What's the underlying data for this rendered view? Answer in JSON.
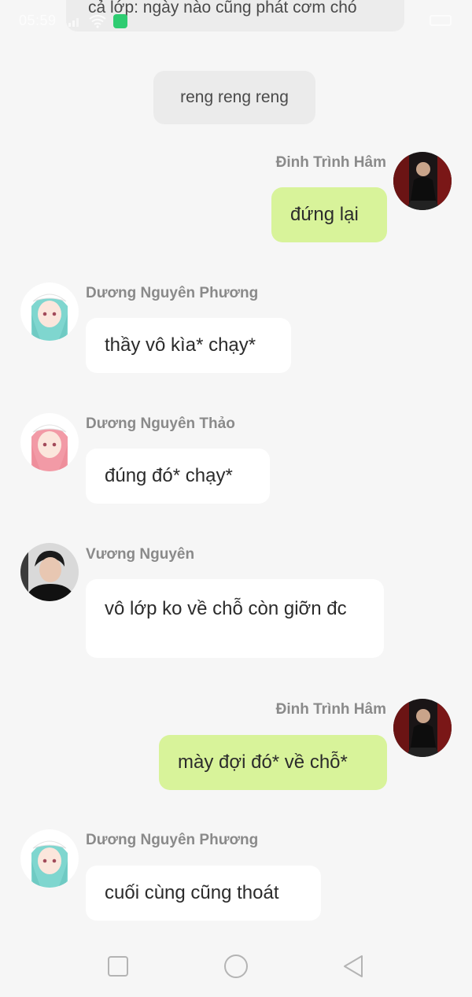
{
  "status_bar": {
    "time": "05:59",
    "wifi_icon": "wifi-icon",
    "signal_icon": "signal-icon",
    "app_icon": "app-notification-icon",
    "battery_icon": "battery-icon"
  },
  "chat": {
    "top_partial_message": "cả lớp: ngày nào cũng phát cơm chó",
    "system_message": "reng reng reng",
    "messages": [
      {
        "sender": "Đinh Trình Hâm",
        "text": "đứng lại",
        "side": "right"
      },
      {
        "sender": "Dương Nguyên Phương",
        "text": "thầy vô kìa* chạy*",
        "side": "left"
      },
      {
        "sender": "Dương Nguyên Thảo",
        "text": "đúng đó* chạy*",
        "side": "left"
      },
      {
        "sender": "Vương Nguyên",
        "text": "vô lớp ko về chỗ còn giỡn đc",
        "side": "left"
      },
      {
        "sender": "Đinh Trình Hâm",
        "text": "mày đợi đó* về chỗ*",
        "side": "right"
      },
      {
        "sender": "Dương Nguyên Phương",
        "text": "cuối cùng cũng thoát",
        "side": "left"
      }
    ]
  },
  "navigation": {
    "recents_icon": "square-recents-icon",
    "home_icon": "circle-home-icon",
    "back_icon": "triangle-back-icon"
  },
  "colors": {
    "background": "#f6f6f6",
    "bubble_self": "#d8f39a",
    "bubble_other": "#ffffff",
    "system_bubble": "#ebebeb",
    "name_text": "#8a8a8a"
  }
}
